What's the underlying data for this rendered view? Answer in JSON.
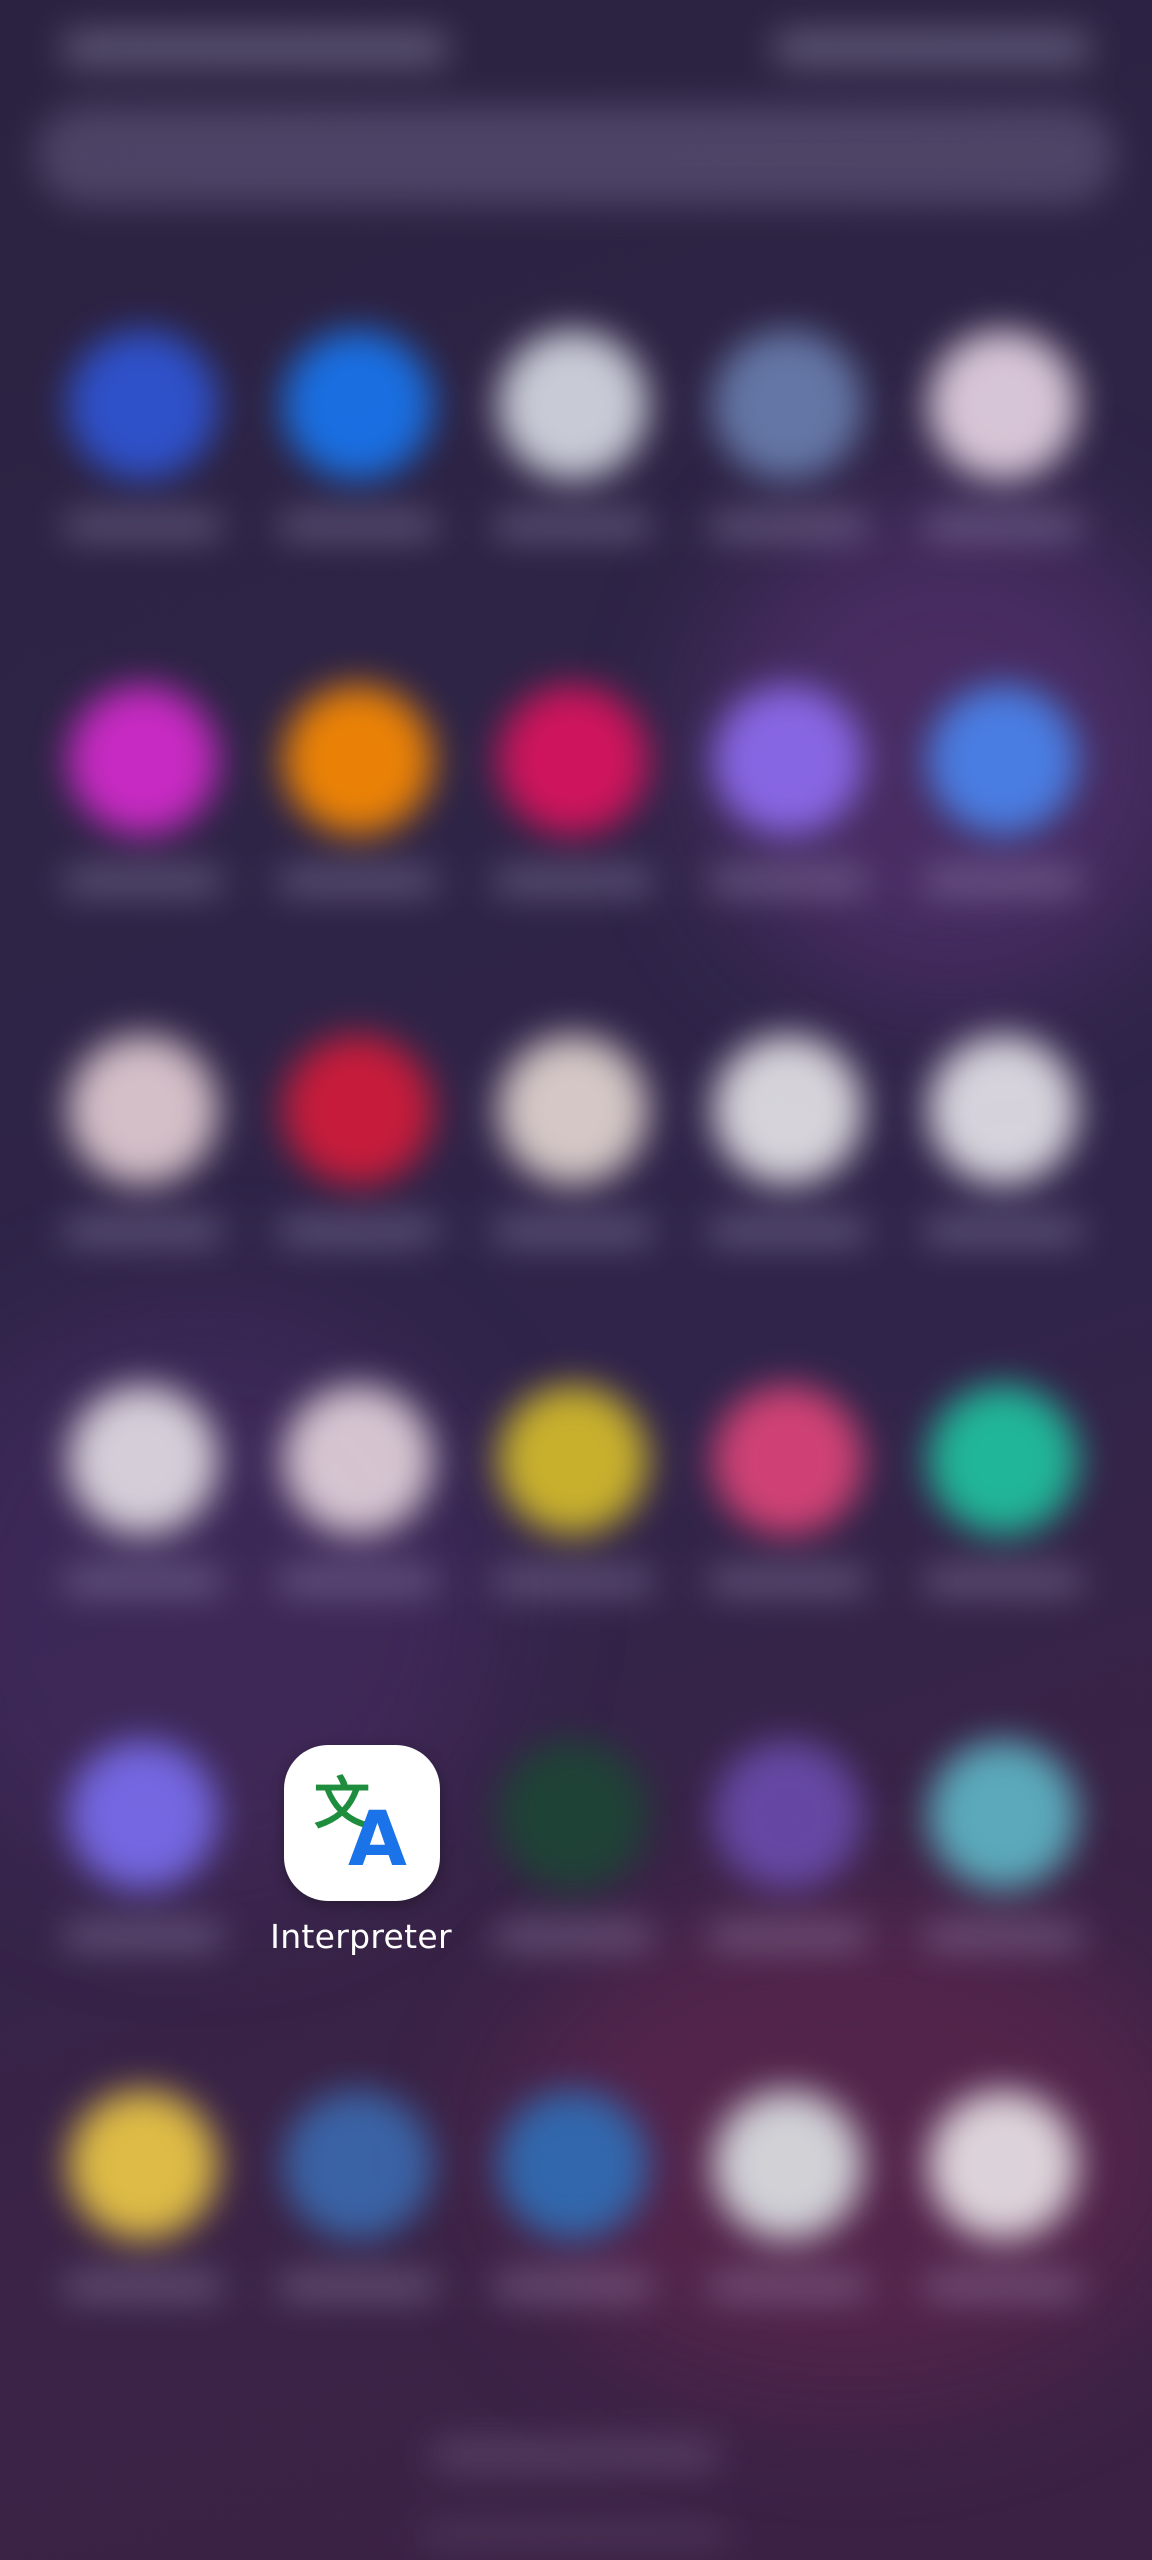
{
  "focused_app": {
    "label": "Interpreter",
    "icon": "translate-icon",
    "glyph_cjk": "文",
    "glyph_latin": "A",
    "colors": {
      "glyph_cjk": "#1e8e3e",
      "glyph_latin": "#1a73e8",
      "background": "#ffffff"
    }
  },
  "blurred_app_icons": [
    {
      "row": 1,
      "col": 1,
      "color": "#2f56d8"
    },
    {
      "row": 1,
      "col": 2,
      "color": "#1877f2"
    },
    {
      "row": 1,
      "col": 3,
      "color": "#d9dde6"
    },
    {
      "row": 1,
      "col": 4,
      "color": "#6a7fb0"
    },
    {
      "row": 1,
      "col": 5,
      "color": "#e9d7e6"
    },
    {
      "row": 2,
      "col": 1,
      "color": "#d82bd0"
    },
    {
      "row": 2,
      "col": 2,
      "color": "#ff8c00"
    },
    {
      "row": 2,
      "col": 3,
      "color": "#e0135f"
    },
    {
      "row": 2,
      "col": 4,
      "color": "#8f6df2"
    },
    {
      "row": 2,
      "col": 5,
      "color": "#4a86f0"
    },
    {
      "row": 3,
      "col": 1,
      "color": "#e6d0d6"
    },
    {
      "row": 3,
      "col": 2,
      "color": "#d81b3a"
    },
    {
      "row": 3,
      "col": 3,
      "color": "#e6d9d3"
    },
    {
      "row": 3,
      "col": 4,
      "color": "#e8e6ea"
    },
    {
      "row": 3,
      "col": 5,
      "color": "#e8e6ec"
    },
    {
      "row": 4,
      "col": 1,
      "color": "#e6e0e6"
    },
    {
      "row": 4,
      "col": 2,
      "color": "#e6d6de"
    },
    {
      "row": 4,
      "col": 3,
      "color": "#d9c02a"
    },
    {
      "row": 4,
      "col": 4,
      "color": "#e1457a"
    },
    {
      "row": 4,
      "col": 5,
      "color": "#1fc6a2"
    },
    {
      "row": 5,
      "col": 1,
      "color": "#7a6ef0"
    },
    {
      "row": 5,
      "col": 3,
      "color": "#1c4634"
    },
    {
      "row": 5,
      "col": 4,
      "color": "#6a4cad"
    },
    {
      "row": 5,
      "col": 5,
      "color": "#5fb8c8"
    },
    {
      "row": 6,
      "col": 1,
      "color": "#f0cc46"
    },
    {
      "row": 6,
      "col": 2,
      "color": "#3a6ab0"
    },
    {
      "row": 6,
      "col": 3,
      "color": "#2f6fb8"
    },
    {
      "row": 6,
      "col": 4,
      "color": "#dfe4e6"
    },
    {
      "row": 6,
      "col": 5,
      "color": "#ece6ea"
    }
  ]
}
